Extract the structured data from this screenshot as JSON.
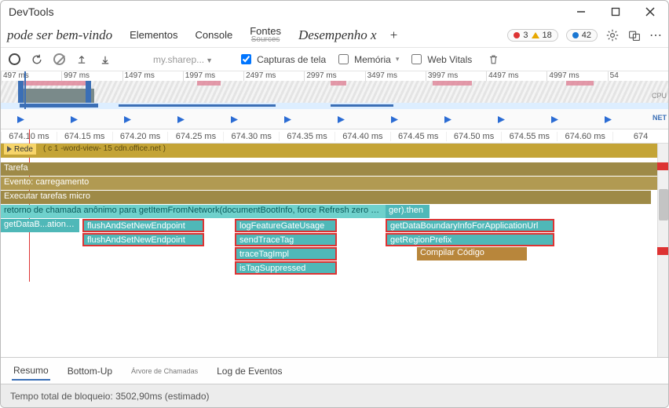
{
  "window": {
    "title": "DevTools"
  },
  "page_heading": "pode ser bem-vindo",
  "tabs": {
    "elements": "Elementos",
    "console": "Console",
    "sources": "Fontes",
    "sources_strike": "Sources",
    "performance": "Desempenho x",
    "plus": "+"
  },
  "counters": {
    "errors": "3",
    "warnings": "18",
    "info": "42"
  },
  "toolbar": {
    "site": "my.sharep...",
    "screenshots": "Capturas de tela",
    "memory": "Memória",
    "web_vitals": "Web Vitals"
  },
  "overview": {
    "ticks": [
      "497 ms",
      "997 ms",
      "1497 ms",
      "1997 ms",
      "2497 ms",
      "2997 ms",
      "3497 ms",
      "3997 ms",
      "4497 ms",
      "4997 ms",
      "54"
    ],
    "cpu_label": "CPU",
    "net_label": "NET"
  },
  "ruler_ms": [
    "674.10 ms",
    "674.15 ms",
    "674.20 ms",
    "674.25 ms",
    "674.30 ms",
    "674.35 ms",
    "674.40 ms",
    "674.45 ms",
    "674.50 ms",
    "674.55 ms",
    "674.60 ms",
    "674"
  ],
  "flame": {
    "rede": "Rede",
    "rede_note": "( c 1 -word-view- 15 cdn.office.net )",
    "tarefa": "Tarefa",
    "evento": "Evento: carregamento",
    "micro": "Executar tarefas micro",
    "anon": "retorno de chamada anônimo para getItemFromNetwork(documentBootInfo, force Refresh zero Byte",
    "then": "ger).then",
    "col1": "getDataB...ationUrl",
    "col2a": "flushAndSetNewEndpoint",
    "col2b": "flushAndSetNewEndpoint",
    "col3a": "logFeatureGateUsage",
    "col3b": "sendTraceTag",
    "col3c": "traceTagImpl",
    "col3d": "isTagSuppressed",
    "col4a": "getDataBoundaryInfoForApplicationUrl",
    "col4b": "getRegionPrefix",
    "compile": "Compilar Código"
  },
  "bottom_tabs": {
    "summary": "Resumo",
    "bottom_up": "Bottom-Up",
    "call_tree": "Árvore de Chamadas",
    "event_log": "Log de Eventos"
  },
  "status": "Tempo total de bloqueio: 3502,90ms (estimado)"
}
